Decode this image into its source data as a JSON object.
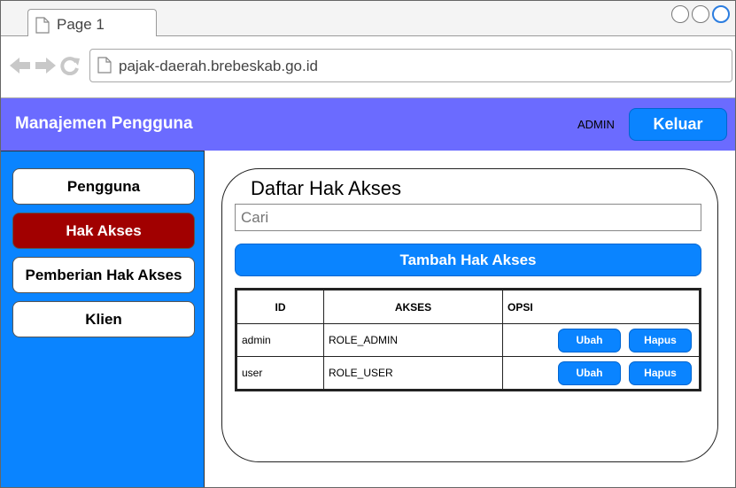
{
  "browser": {
    "tab_label": "Page 1",
    "url": "pajak-daerah.brebeskab.go.id"
  },
  "header": {
    "title": "Manajemen Pengguna",
    "user": "ADMIN",
    "logout_label": "Keluar"
  },
  "sidebar": {
    "items": [
      {
        "label": "Pengguna",
        "active": false
      },
      {
        "label": "Hak Akses",
        "active": true
      },
      {
        "label": "Pemberian Hak Akses",
        "active": false
      },
      {
        "label": "Klien",
        "active": false
      }
    ]
  },
  "main": {
    "title": "Daftar Hak Akses",
    "search_placeholder": "Cari",
    "add_label": "Tambah Hak Akses",
    "table": {
      "columns": [
        "ID",
        "AKSES",
        "OPSI"
      ],
      "rows": [
        {
          "id": "admin",
          "akses": "ROLE_ADMIN",
          "edit": "Ubah",
          "delete": "Hapus"
        },
        {
          "id": "user",
          "akses": "ROLE_USER",
          "edit": "Ubah",
          "delete": "Hapus"
        }
      ]
    }
  },
  "colors": {
    "header_bg": "#6b6bff",
    "sidebar_bg": "#0a84ff",
    "active_item": "#a10000",
    "button": "#0a84ff"
  },
  "icons": [
    "page-icon",
    "back-arrow-icon",
    "forward-arrow-icon",
    "reload-icon"
  ]
}
